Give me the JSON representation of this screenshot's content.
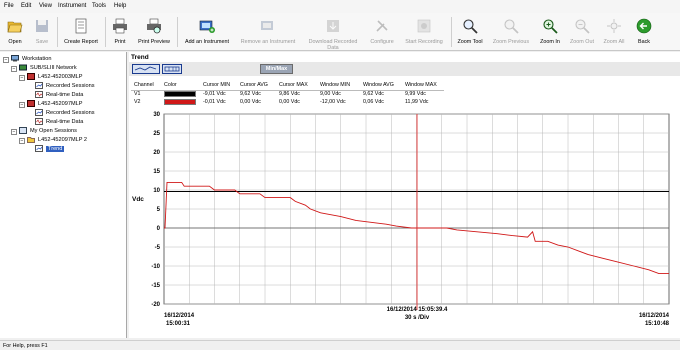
{
  "menu": [
    "File",
    "Edit",
    "View",
    "Instrument",
    "Tools",
    "Help"
  ],
  "toolbar": {
    "open": "Open",
    "save": "Save",
    "create_report": "Create Report",
    "print": "Print",
    "print_preview": "Print Preview",
    "add_instrument": "Add an Instrument",
    "remove_instrument": "Remove an Instrument",
    "download": "Download Recorded Data",
    "download_line1": "Download Recorded",
    "download_line2": "Data",
    "configure": "Configure",
    "start_recording": "Start Recording",
    "zoom_tool": "Zoom Tool",
    "zoom_previous": "Zoom Previous",
    "zoom_in": "Zoom In",
    "zoom_out": "Zoom Out",
    "zoom_all": "Zoom All",
    "back": "Back"
  },
  "tree": {
    "workstation": "Workstation",
    "network": "SUB/SLIII Network",
    "inst1": "L452-452003MLP",
    "inst1_recorded": "Recorded Sessions",
    "inst1_realtime": "Real-time Data",
    "inst2": "L452-452097MLP",
    "inst2_recorded": "Recorded Sessions",
    "inst2_realtime": "Real-time Data",
    "open_sessions": "My Open Sessions",
    "session_inst": "L452-452097MLP 2",
    "trend": "Trend"
  },
  "panel": {
    "title": "Trend",
    "minmax_label": "Min/Max"
  },
  "stats_table": {
    "headers": [
      "Channel",
      "Color",
      "Cursor MIN",
      "Cursor AVG",
      "Cursor MAX",
      "Window MIN",
      "Window AVG",
      "Window MAX"
    ],
    "rows": [
      {
        "channel": "V1",
        "color": "#000000",
        "cursor_min": "-9,01 Vdc",
        "cursor_avg": "9,62 Vdc",
        "cursor_max": "9,86 Vdc",
        "window_min": "9,00 Vdc",
        "window_avg": "9,62 Vdc",
        "window_max": "9,99 Vdc"
      },
      {
        "channel": "V2",
        "color": "#d01818",
        "cursor_min": "-0,01 Vdc",
        "cursor_avg": "0,00 Vdc",
        "cursor_max": "0,00 Vdc",
        "window_min": "-12,00 Vdc",
        "window_avg": "0,06 Vdc",
        "window_max": "11,99 Vdc"
      }
    ]
  },
  "chart_data": {
    "type": "line",
    "ylabel": "Vdc",
    "ylim": [
      -20,
      30
    ],
    "yticks": [
      30,
      25,
      20,
      15,
      10,
      5,
      0,
      -5,
      -10,
      -15,
      -20
    ],
    "x_start": {
      "date": "16/12/2014",
      "time": "15:00:31"
    },
    "x_end": {
      "date": "16/12/2014",
      "time": "15:10:48"
    },
    "cursor": {
      "label": "16/12/2014 15:05:39.4",
      "x_fraction": 0.501
    },
    "scale_label": "30 s /Div",
    "grid": true,
    "series": [
      {
        "name": "V1",
        "color": "#000000",
        "points": [
          [
            0,
            9.6
          ],
          [
            1,
            9.6
          ]
        ]
      },
      {
        "name": "V2",
        "color": "#d01818",
        "points": [
          [
            0,
            0
          ],
          [
            0.002,
            0
          ],
          [
            0.006,
            12.0
          ],
          [
            0.035,
            12.0
          ],
          [
            0.04,
            11.0
          ],
          [
            0.09,
            11.0
          ],
          [
            0.1,
            10.0
          ],
          [
            0.14,
            10.0
          ],
          [
            0.15,
            9.0
          ],
          [
            0.19,
            9.0
          ],
          [
            0.2,
            8.0
          ],
          [
            0.25,
            8.0
          ],
          [
            0.26,
            7.0
          ],
          [
            0.28,
            6.0
          ],
          [
            0.29,
            5.0
          ],
          [
            0.31,
            4.0
          ],
          [
            0.33,
            3.5
          ],
          [
            0.35,
            3.0
          ],
          [
            0.38,
            2.0
          ],
          [
            0.41,
            1.5
          ],
          [
            0.44,
            1.0
          ],
          [
            0.46,
            0.5
          ],
          [
            0.49,
            0.0
          ],
          [
            0.56,
            0.0
          ],
          [
            0.58,
            -0.5
          ],
          [
            0.62,
            -1.0
          ],
          [
            0.66,
            -1.5
          ],
          [
            0.69,
            -2.0
          ],
          [
            0.72,
            -2.4
          ],
          [
            0.73,
            -1.0
          ],
          [
            0.735,
            -3.5
          ],
          [
            0.76,
            -3.5
          ],
          [
            0.78,
            -4.5
          ],
          [
            0.8,
            -5.0
          ],
          [
            0.82,
            -6.0
          ],
          [
            0.84,
            -7.0
          ],
          [
            0.87,
            -8.0
          ],
          [
            0.9,
            -9.0
          ],
          [
            0.93,
            -10.0
          ],
          [
            0.96,
            -11.0
          ],
          [
            0.98,
            -12.0
          ],
          [
            1.0,
            -12.0
          ]
        ]
      }
    ]
  },
  "status": "For Help, press F1",
  "colors": {
    "accent": "#1e56c8",
    "v1": "#000000",
    "v2": "#d01818",
    "cursor": "#e03030"
  }
}
